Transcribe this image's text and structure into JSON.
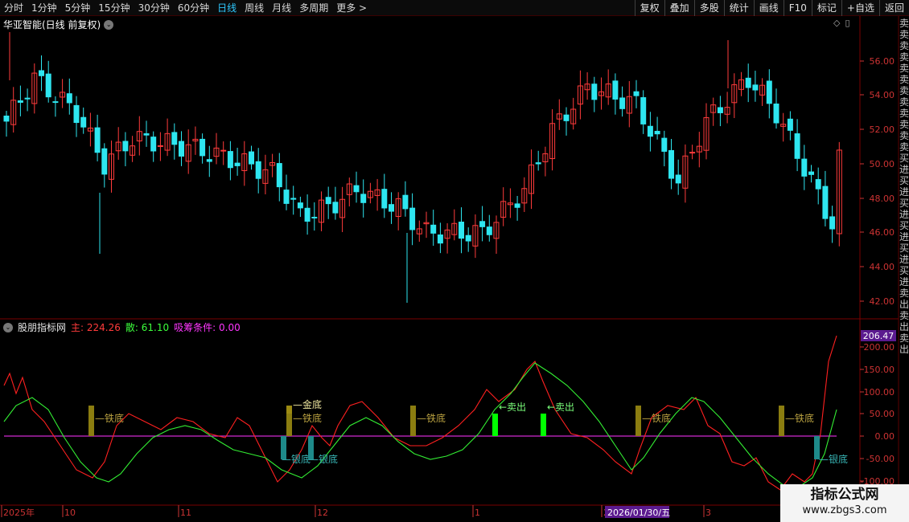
{
  "toolbar": {
    "timeframes": [
      "分时",
      "1分钟",
      "5分钟",
      "15分钟",
      "30分钟",
      "60分钟",
      "日线",
      "周线",
      "月线",
      "多周期",
      "更多 >"
    ],
    "active_timeframe": "日线",
    "tools": [
      "复权",
      "叠加",
      "多股",
      "统计",
      "画线",
      "F10",
      "标记",
      "+自选",
      "返回"
    ]
  },
  "main_chart": {
    "stock_title": "华亚智能(日线 前复权)",
    "price_ticks": [
      "56.00",
      "54.00",
      "52.00",
      "50.00",
      "48.00",
      "46.00",
      "44.00",
      "42.00"
    ]
  },
  "indicator": {
    "name": "股朋指标网",
    "main_label": "主:",
    "main_value": "224.26",
    "san_label": "散:",
    "san_value": "61.10",
    "xc_label": "吸筹条件:",
    "xc_value": "0.00",
    "current_value_badge": "206.47",
    "y_ticks": [
      "200.00",
      "150.00",
      "100.00",
      "50.00",
      "0.00",
      "-50.00",
      "-100.00"
    ],
    "signals": [
      {
        "text": "—铁底",
        "kind": "iron"
      },
      {
        "text": "—金底",
        "kind": "gold"
      },
      {
        "text": "—铁底",
        "kind": "iron"
      },
      {
        "text": "—银底",
        "kind": "silver"
      },
      {
        "text": "—银底",
        "kind": "silver"
      },
      {
        "text": "—铁底",
        "kind": "iron"
      },
      {
        "text": "←卖出",
        "kind": "sell"
      },
      {
        "text": "←卖出",
        "kind": "sell"
      },
      {
        "text": "—铁底",
        "kind": "iron"
      },
      {
        "text": "—铁底",
        "kind": "iron"
      },
      {
        "text": "—银底",
        "kind": "silver"
      }
    ]
  },
  "date_axis": {
    "labels": [
      "2025年",
      "10",
      "11",
      "12",
      "1",
      "2",
      "3"
    ],
    "cursor_date": "2026/01/30/五"
  },
  "sidebar_text": "卖卖卖卖卖卖卖卖卖卖卖卖买进买进买进买进买进买进卖出卖出卖出",
  "watermark": {
    "title": "指标公式网",
    "url": "www.zbgs3.com"
  },
  "colors": {
    "up": "#ff3b3b",
    "down": "#2ee6f0",
    "main_line": "#ff2020",
    "san_line": "#33ee33",
    "zero_line": "#d02ad0",
    "iron": "#8b7d10",
    "gold": "#9c8a12",
    "silver": "#1e8a8a",
    "sell": "#00ff00"
  }
}
